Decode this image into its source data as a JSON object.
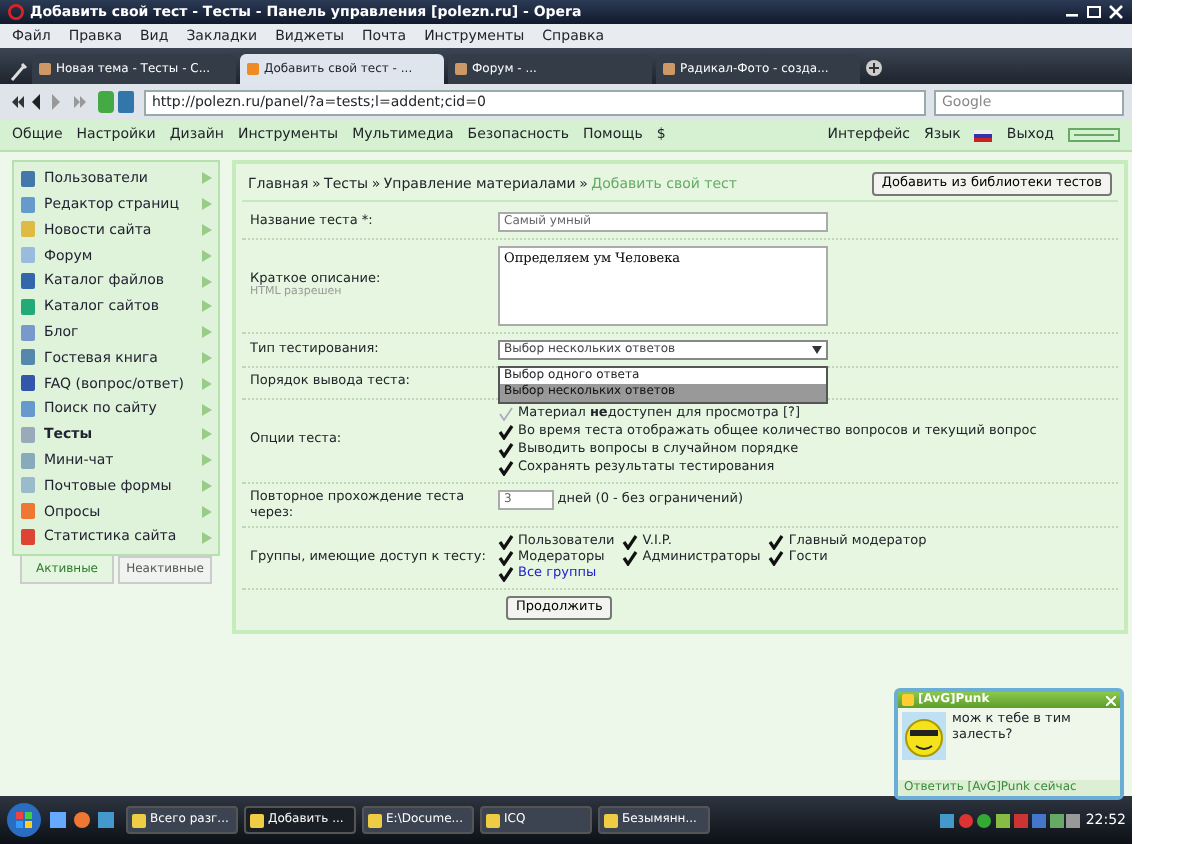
{
  "window": {
    "title": "Добавить свой тест - Тесты - Панель управления [polezn.ru] - Opera"
  },
  "menu": [
    "Файл",
    "Правка",
    "Вид",
    "Закладки",
    "Виджеты",
    "Почта",
    "Инструменты",
    "Справка"
  ],
  "tabs": [
    {
      "label": "Новая тема - Тесты - С...",
      "selected": false
    },
    {
      "label": "Добавить свой тест - ...",
      "selected": true
    },
    {
      "label": "Форум - ...",
      "selected": false
    },
    {
      "label": "Радикал-Фото - созда...",
      "selected": false
    }
  ],
  "address": {
    "url": "http://polezn.ru/panel/?a=tests;l=addent;cid=0",
    "search": "Google"
  },
  "nav": {
    "items": [
      "Общие",
      "Настройки",
      "Дизайн",
      "Инструменты",
      "Мультимедиа",
      "Безопасность",
      "Помощь",
      "$"
    ],
    "interface": "Интерфейс",
    "language": "Язык",
    "logout": "Выход"
  },
  "sidebar": {
    "items": [
      {
        "label": "Пользователи",
        "selected": false
      },
      {
        "label": "Редактор страниц",
        "selected": false
      },
      {
        "label": "Новости сайта",
        "selected": false
      },
      {
        "label": "Форум",
        "selected": false
      },
      {
        "label": "Каталог файлов",
        "selected": false
      },
      {
        "label": "Каталог сайтов",
        "selected": false
      },
      {
        "label": "Блог",
        "selected": false
      },
      {
        "label": "Гостевая книга",
        "selected": false
      },
      {
        "label": "FAQ (вопрос/ответ)",
        "selected": false
      },
      {
        "label": "Поиск по сайту",
        "selected": false
      },
      {
        "label": "Тесты",
        "selected": true
      },
      {
        "label": "Мини-чат",
        "selected": false
      },
      {
        "label": "Почтовые формы",
        "selected": false
      },
      {
        "label": "Опросы",
        "selected": false
      },
      {
        "label": "Статистика сайта",
        "selected": false
      }
    ],
    "tabs": [
      {
        "label": "Активные",
        "selected": true
      },
      {
        "label": "Неактивные",
        "selected": false
      }
    ]
  },
  "breadcrumb": [
    "Главная",
    "Тесты",
    "Управление материалами",
    "Добавить свой тест"
  ],
  "breadcrumb_separator": "»",
  "library_button": "Добавить из библиотеки тестов",
  "form": {
    "name_label": "Название теста *:",
    "name_value": "Самый умный",
    "description_label": "Краткое описание:",
    "description_hint": "HTML разрешен",
    "description_value": "Определяем ум Человека",
    "type_label": "Тип тестирования:",
    "type_value": "Выбор нескольких ответов",
    "type_options": [
      {
        "label": "Выбор одного ответа",
        "selected": false
      },
      {
        "label": "Выбор нескольких ответов",
        "selected": true
      }
    ],
    "order_label": "Порядок вывода теста:",
    "options_label": "Опции теста:",
    "options": [
      {
        "label": "Материал **не**доступен для просмотра [?]",
        "checked": false
      },
      {
        "label": "Во время теста отображать общее количество вопросов и текущий вопрос",
        "checked": true
      },
      {
        "label": "Выводить вопросы в случайном порядке",
        "checked": true
      },
      {
        "label": "Сохранять результаты тестирования",
        "checked": true
      }
    ],
    "repeat_label": "Повторное прохождение теста через:",
    "repeat_value": "3",
    "repeat_unit": "дней (0 - без ограничений)",
    "groups_label": "Группы, имеющие доступ к тесту:",
    "groups": [
      {
        "label": "Пользователи",
        "checked": true
      },
      {
        "label": "V.I.P.",
        "checked": true
      },
      {
        "label": "Главный модератор",
        "checked": true
      },
      {
        "label": "Модераторы",
        "checked": true
      },
      {
        "label": "Администраторы",
        "checked": true
      },
      {
        "label": "Гости",
        "checked": true
      },
      {
        "label": "Все группы",
        "checked": true
      }
    ],
    "submit": "Продолжить"
  },
  "popup": {
    "title": "[AvG]Punk",
    "message": "мож к тебе в тим залесть?",
    "reply": "Ответить [AvG]Punk сейчас"
  },
  "taskbar": {
    "tasks": [
      {
        "label": "Всего разг...",
        "selected": false
      },
      {
        "label": "Добавить ...",
        "selected": true
      },
      {
        "label": "E:\\Docume...",
        "selected": false
      },
      {
        "label": "ICQ",
        "selected": false
      },
      {
        "label": "Безымянн...",
        "selected": false
      }
    ],
    "clock": "22:52"
  }
}
